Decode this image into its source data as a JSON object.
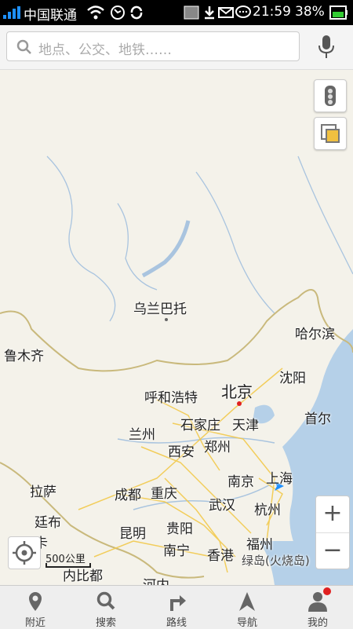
{
  "status_bar": {
    "carrier": "中国联通",
    "time": "21:59",
    "battery": "38%"
  },
  "search": {
    "placeholder": "地点、公交、地铁……"
  },
  "map": {
    "cities": [
      "乌兰巴托",
      "哈尔滨",
      "鲁木齐",
      "沈阳",
      "呼和浩特",
      "北京",
      "首尔",
      "石家庄",
      "天津",
      "兰州",
      "西安",
      "郑州",
      "拉萨",
      "成都",
      "重庆",
      "南京",
      "上海",
      "武汉",
      "杭州",
      "廷布",
      "昆明",
      "贵阳",
      "福州",
      "南宁",
      "香港",
      "绿岛(火烧岛)",
      "卡",
      "内比都",
      "河内"
    ],
    "scale_label": "500公里"
  },
  "tabs": [
    {
      "label": "附近",
      "icon": "location-pin-icon"
    },
    {
      "label": "搜索",
      "icon": "search-icon"
    },
    {
      "label": "路线",
      "icon": "route-icon"
    },
    {
      "label": "导航",
      "icon": "navigation-arrow-icon"
    },
    {
      "label": "我的",
      "icon": "user-icon"
    }
  ],
  "colors": {
    "water": "#b5d0e8",
    "border": "#c9b97c",
    "road": "#f2c94c",
    "accent": "#1e90ff"
  }
}
